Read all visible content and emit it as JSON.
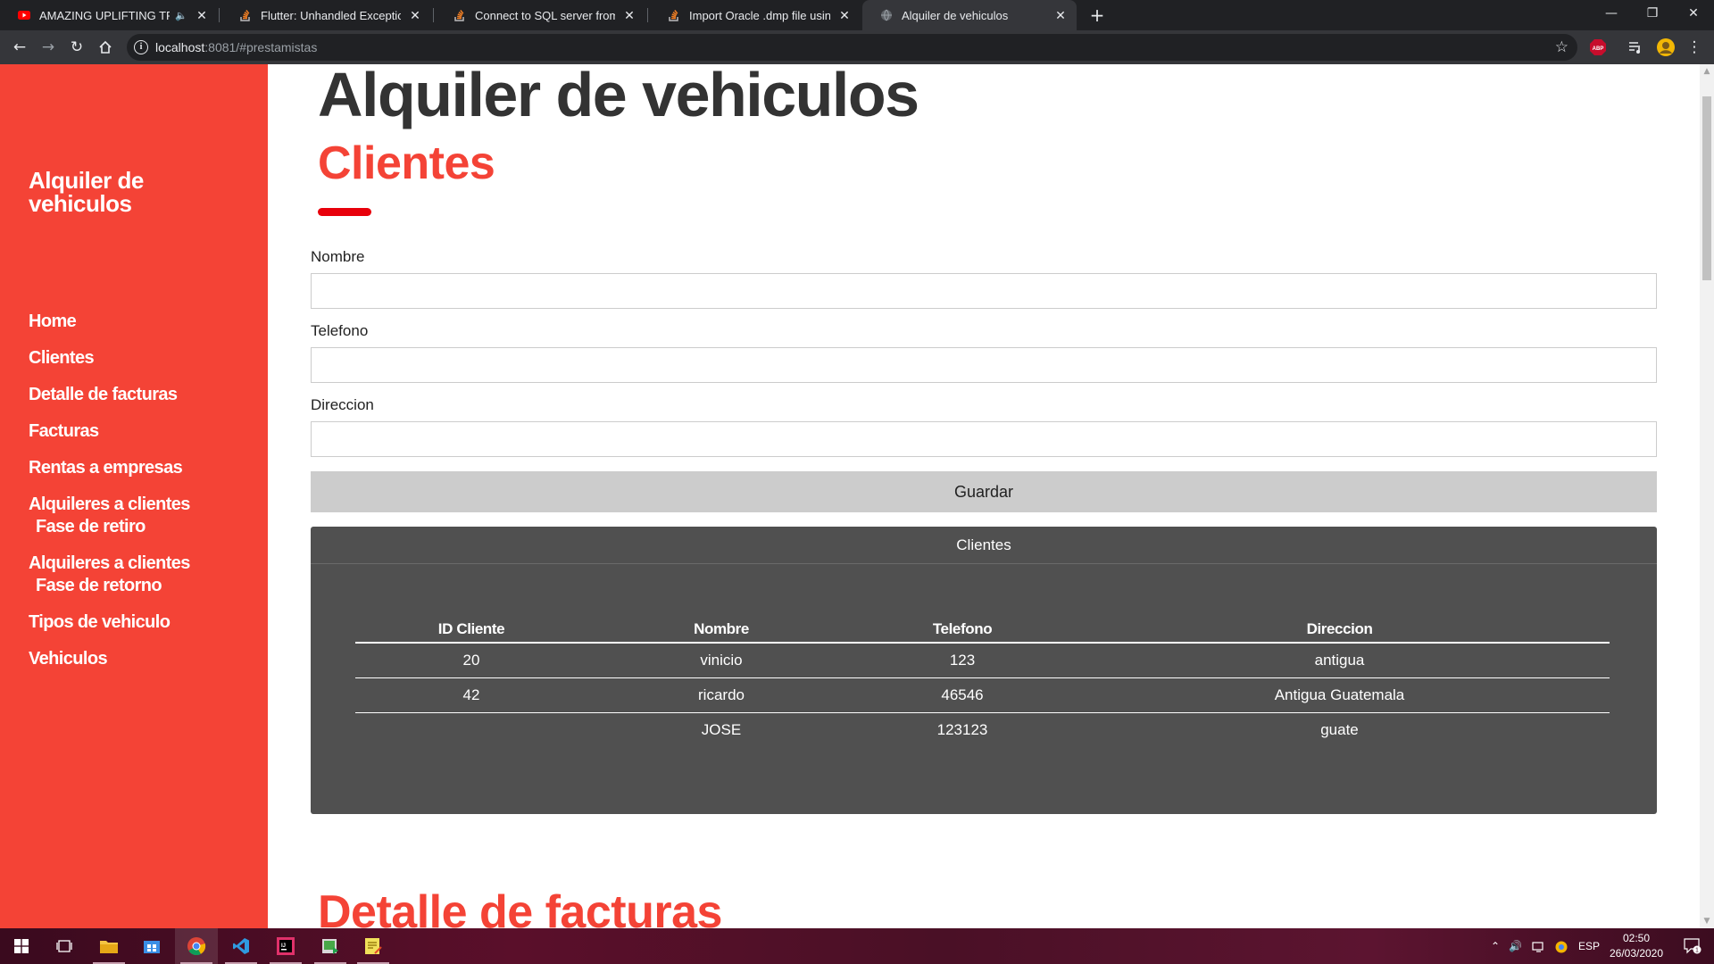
{
  "browser": {
    "tabs": [
      {
        "title": "AMAZING UPLIFTING TRANC",
        "favicon": "youtube-icon",
        "muted_indicator": "🔈",
        "active": false
      },
      {
        "title": "Flutter: Unhandled Exception: Se",
        "favicon": "stackoverflow-icon",
        "active": false
      },
      {
        "title": "Connect to SQL server from PHP",
        "favicon": "stackoverflow-icon",
        "active": false
      },
      {
        "title": "Import Oracle .dmp file using SQ",
        "favicon": "stackoverflow-icon",
        "active": false
      },
      {
        "title": "Alquiler de vehiculos",
        "favicon": "globe-icon",
        "active": true
      }
    ],
    "url_host": "localhost",
    "url_rest": ":8081/#prestamistas",
    "extension_badge": "ABP"
  },
  "sidebar": {
    "brand": "Alquiler de vehiculos",
    "nav": [
      {
        "label": "Home"
      },
      {
        "label": "Clientes"
      },
      {
        "label": "Detalle de facturas"
      },
      {
        "label": "Facturas"
      },
      {
        "label": "Rentas a empresas"
      },
      {
        "label": "Alquileres a clientes",
        "sub": "Fase de retiro"
      },
      {
        "label": "Alquileres a clientes",
        "sub": "Fase de retorno"
      },
      {
        "label": "Tipos de vehiculo"
      },
      {
        "label": "Vehiculos"
      }
    ]
  },
  "main": {
    "site_title": "Alquiler de vehiculos",
    "section_title": "Clientes",
    "form": {
      "nombre_label": "Nombre",
      "nombre_value": "",
      "telefono_label": "Telefono",
      "telefono_value": "",
      "direccion_label": "Direccion",
      "direccion_value": "",
      "save_label": "Guardar"
    },
    "table_panel": {
      "heading": "Clientes",
      "columns": [
        "ID Cliente",
        "Nombre",
        "Telefono",
        "Direccion"
      ],
      "rows": [
        [
          "20",
          "vinicio",
          "123",
          "antigua"
        ],
        [
          "42",
          "ricardo",
          "46546",
          "Antigua Guatemala"
        ],
        [
          "",
          "JOSE",
          "123123",
          "guate"
        ]
      ]
    },
    "next_section_title": "Detalle de facturas"
  },
  "taskbar": {
    "language": "ESP",
    "time": "02:50",
    "date": "26/03/2020",
    "notification_count": "1"
  },
  "colors": {
    "accent_red": "#f44336",
    "underline_red": "#e8000b",
    "panel_gray": "#505050",
    "button_gray": "#cccccc",
    "chrome_dark": "#202124",
    "chrome_toolbar": "#35363a"
  }
}
